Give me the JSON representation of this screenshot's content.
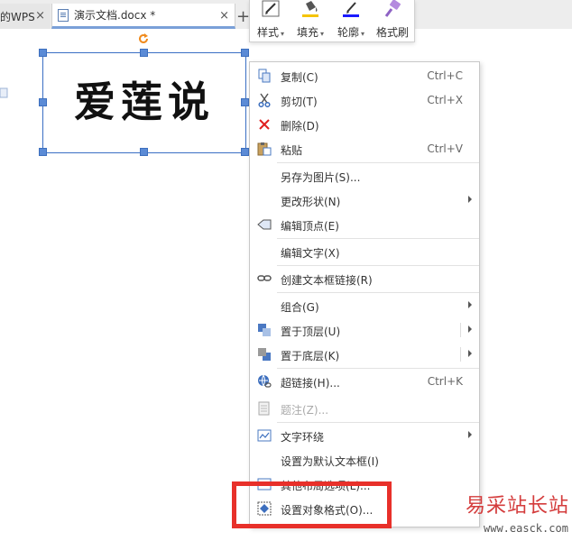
{
  "tabs": {
    "previous": {
      "label": "的WPS",
      "close": "×"
    },
    "active": {
      "label": "演示文档.docx *",
      "close": "×"
    },
    "new_tab": "+"
  },
  "mini_toolbar": {
    "style": "样式",
    "fill": "填充",
    "outline": "轮廓",
    "format_painter": "格式刷",
    "dropdown": "▾",
    "colors": {
      "fill": "#f5c400",
      "outline": "#1a1aff"
    }
  },
  "canvas": {
    "word_art": "爱莲说"
  },
  "context_menu": {
    "items": [
      {
        "label": "复制(C)",
        "shortcut": "Ctrl+C",
        "icon": "copy-icon"
      },
      {
        "label": "剪切(T)",
        "shortcut": "Ctrl+X",
        "icon": "scissors-icon"
      },
      {
        "label": "删除(D)",
        "shortcut": "",
        "icon": "delete-icon"
      },
      {
        "label": "粘贴",
        "shortcut": "Ctrl+V",
        "icon": "paste-icon"
      },
      {
        "label": "另存为图片(S)...",
        "shortcut": "",
        "icon": ""
      },
      {
        "label": "更改形状(N)",
        "shortcut": "",
        "icon": ""
      },
      {
        "label": "编辑顶点(E)",
        "shortcut": "",
        "icon": "edit-points-icon"
      },
      {
        "label": "编辑文字(X)",
        "shortcut": "",
        "icon": ""
      },
      {
        "label": "创建文本框链接(R)",
        "shortcut": "",
        "icon": "link-chain-icon"
      },
      {
        "label": "组合(G)",
        "shortcut": "",
        "icon": ""
      },
      {
        "label": "置于顶层(U)",
        "shortcut": "",
        "icon": "bring-to-front-icon"
      },
      {
        "label": "置于底层(K)",
        "shortcut": "",
        "icon": "send-to-back-icon"
      },
      {
        "label": "超链接(H)...",
        "shortcut": "Ctrl+K",
        "icon": "hyperlink-icon"
      },
      {
        "label": "题注(Z)...",
        "shortcut": "",
        "icon": "caption-icon"
      },
      {
        "label": "文字环绕",
        "shortcut": "",
        "icon": "text-wrap-icon"
      },
      {
        "label": "设置为默认文本框(I)",
        "shortcut": "",
        "icon": ""
      },
      {
        "label": "其他布局选项(L)...",
        "shortcut": "",
        "icon": "layout-options-icon"
      },
      {
        "label": "设置对象格式(O)...",
        "shortcut": "",
        "icon": "format-object-icon"
      }
    ]
  },
  "watermark": {
    "name": "易采站长站",
    "url": "www.easck.com"
  },
  "highlight_color": "#e8302a"
}
